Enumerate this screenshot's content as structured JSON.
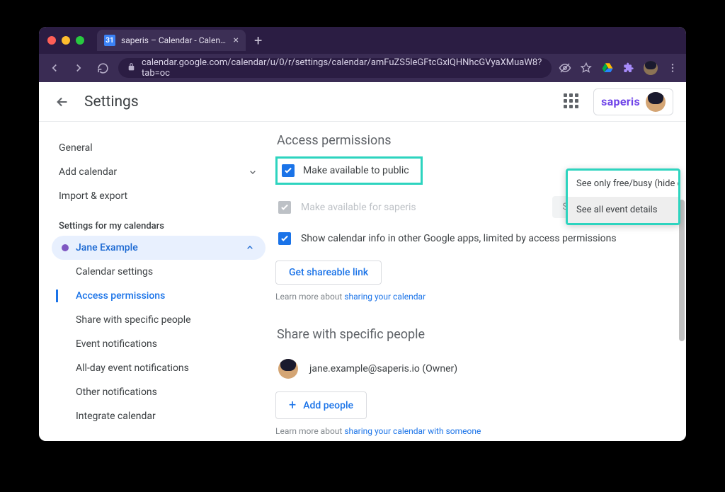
{
  "browser": {
    "tab_title": "saperis – Calendar - Calendar s",
    "url": "calendar.google.com/calendar/u/0/r/settings/calendar/amFuZS5leGFtcGxlQHNhcGVyaXMuaW8?tab=oc"
  },
  "header": {
    "title": "Settings",
    "brand": "saperis"
  },
  "sidebar": {
    "items": [
      {
        "label": "General"
      },
      {
        "label": "Add calendar"
      },
      {
        "label": "Import & export"
      }
    ],
    "section_title": "Settings for my calendars",
    "active_calendar": "Jane Example",
    "sub_items": [
      {
        "label": "Calendar settings"
      },
      {
        "label": "Access permissions"
      },
      {
        "label": "Share with specific people"
      },
      {
        "label": "Event notifications"
      },
      {
        "label": "All-day event notifications"
      },
      {
        "label": "Other notifications"
      },
      {
        "label": "Integrate calendar"
      }
    ]
  },
  "main": {
    "access_title": "Access permissions",
    "perm_public": "Make available to public",
    "perm_org": "Make available for saperis",
    "perm_org_dropdown": "See all event details",
    "perm_info": "Show calendar info in other Google apps, limited by access permissions",
    "get_link": "Get shareable link",
    "learn_prefix": "Learn more about ",
    "learn_link1": "sharing your calendar",
    "share_title": "Share with specific people",
    "share_owner": "jane.example@saperis.io (Owner)",
    "add_people": "Add people",
    "learn_link2": "sharing your calendar with someone"
  },
  "dropdown": {
    "option1": "See only free/busy (hide details)",
    "option2": "See all event details"
  }
}
